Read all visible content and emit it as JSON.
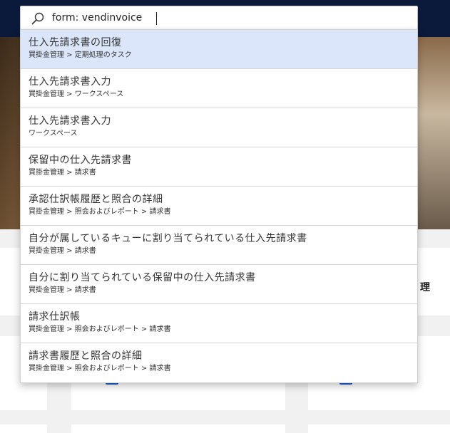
{
  "search": {
    "value": "form: vendinvoice"
  },
  "results": [
    {
      "title": "仕入先請求書の回復",
      "path": "買掛金管理 > 定期処理のタスク"
    },
    {
      "title": "仕入先請求書入力",
      "path": "買掛金管理 > ワークスペース"
    },
    {
      "title": "仕入先請求書入力",
      "path": "ワークスペース"
    },
    {
      "title": "保留中の仕入先請求書",
      "path": "買掛金管理 > 請求書"
    },
    {
      "title": "承認仕訳帳履歴と照合の詳細",
      "path": "買掛金管理 > 照会およびレポート > 請求書"
    },
    {
      "title": "自分が属しているキューに割り当てられている仕入先請求書",
      "path": "買掛金管理 > 請求書"
    },
    {
      "title": "自分に割り当てられている保留中の仕入先請求書",
      "path": "買掛金管理 > 請求書"
    },
    {
      "title": "請求仕訳帳",
      "path": "買掛金管理 > 照会およびレポート > 請求書"
    },
    {
      "title": "請求書履歴と照合の詳細",
      "path": "買掛金管理 > 照会およびレポート > 請求書"
    }
  ],
  "background": {
    "tile_label_fragment": "理"
  },
  "colors": {
    "topbar": "#0b1a3a",
    "selected_row": "#dbe6fa",
    "accent": "#1a5fd0"
  }
}
